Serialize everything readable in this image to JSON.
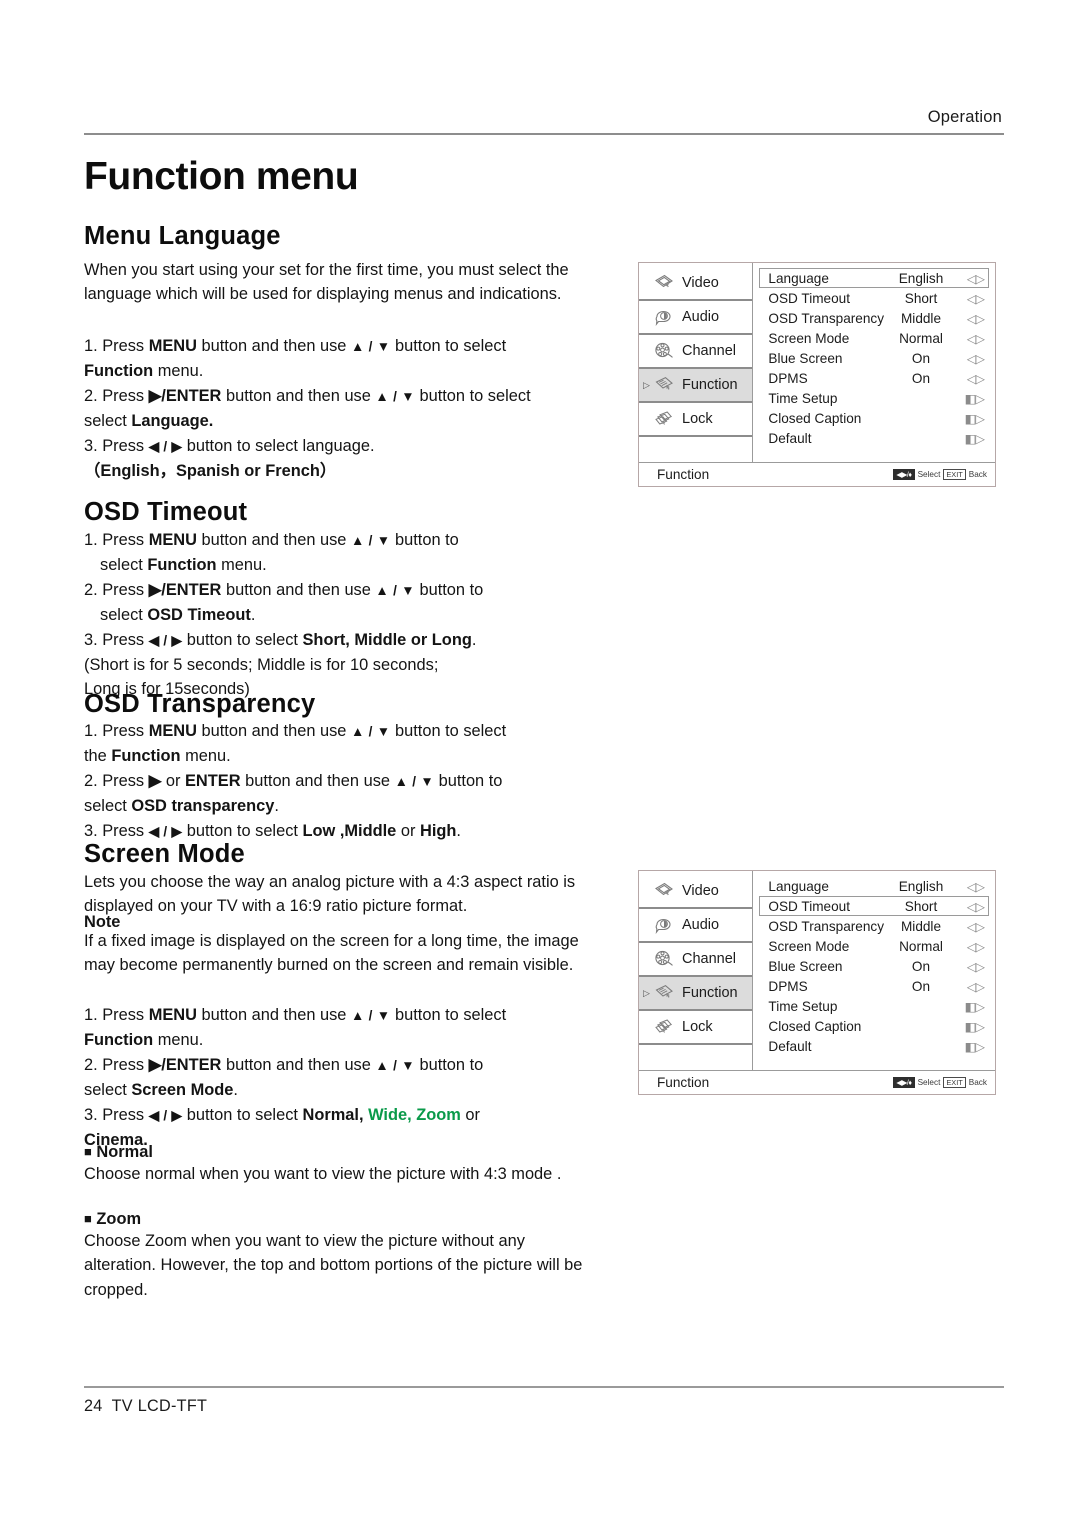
{
  "header": {
    "section": "Operation"
  },
  "title": "Function menu",
  "sections": {
    "menu_language": {
      "heading": "Menu Language",
      "intro": "When you start using your set for the first time, you must select the language which will be used for displaying menus and indications.",
      "step1_a": "1. Press ",
      "step1_b": "MENU",
      "step1_c": " button and then use ",
      "step1_arrows": "▲ / ▼",
      "step1_d": " button to select ",
      "step1_e": "Function",
      "step1_f": " menu.",
      "step2_a": "2. Press ",
      "step2_b": "▶/ENTER",
      "step2_c": " button and then use ",
      "step2_arrows": "▲ / ▼",
      "step2_d": " button to select ",
      "step2_e": "Language.",
      "step3_a": "3. Press ",
      "step3_arrows": "◀ / ▶",
      "step3_b": " button to select  language.",
      "languages": "（English，Spanish or French）"
    },
    "osd_timeout": {
      "heading": "OSD Timeout",
      "step1_a": "1. Press ",
      "step1_b": "MENU",
      "step1_c": " button and then use ",
      "step1_arrows": "▲ / ▼",
      "step1_d": " button to",
      "step1_e": "select ",
      "step1_f": "Function",
      "step1_g": " menu.",
      "step2_a": "2. Press ",
      "step2_b": "▶/ENTER",
      "step2_c": " button and then use ",
      "step2_arrows": "▲ / ▼",
      "step2_d": " button to",
      "step2_e": "select ",
      "step2_f": "OSD Timeout",
      "step2_g": ".",
      "step3_a": "3. Press ",
      "step3_arrows": "◀ / ▶",
      "step3_b": " button to select ",
      "step3_c": "Short, Middle or Long",
      "step3_d": ".",
      "note1": "(Short is for 5 seconds; Middle is for 10 seconds;",
      "note2": "Long is for 15seconds)"
    },
    "osd_transparency": {
      "heading": "OSD Transparency",
      "step1_a": "1. Press ",
      "step1_b": "MENU",
      "step1_c": " button and then use ",
      "step1_arrows": "▲ / ▼",
      "step1_d": " button to select",
      "step1_e": "the ",
      "step1_f": "Function",
      "step1_g": " menu.",
      "step2_a": "2. Press ",
      "step2_b": "▶",
      "step2_c": " or ",
      "step2_d": "ENTER",
      "step2_e": " button and then use ",
      "step2_arrows": "▲ / ▼",
      "step2_f": " button to",
      "step2_g": "select ",
      "step2_h": "OSD transparency",
      "step2_i": ".",
      "step3_a": "3. Press ",
      "step3_arrows": "◀ / ▶",
      "step3_b": " button to select ",
      "step3_c": "Low ,Middle",
      "step3_d": " or ",
      "step3_e": "High",
      "step3_f": "."
    },
    "screen_mode": {
      "heading": "Screen Mode",
      "intro": "Lets you choose the way an analog picture with a 4:3 aspect ratio is displayed on your TV with a 16:9 ratio picture format.",
      "note_label": "Note",
      "note_body": "If a fixed image is displayed on the screen for a long time, the image may become permanently burned on the screen and remain visible.",
      "step1_a": "1. Press ",
      "step1_b": "MENU",
      "step1_c": " button and then use ",
      "step1_arrows": "▲ / ▼",
      "step1_d": " button to select",
      "step1_e": "Function",
      "step1_f": " menu.",
      "step2_a": "2. Press ",
      "step2_b": "▶/ENTER",
      "step2_c": " button and then use ",
      "step2_arrows": "▲ / ▼",
      "step2_d": " button to",
      "step2_e": "select ",
      "step2_f": "Screen Mode",
      "step2_g": ".",
      "step3_a": "3. Press ",
      "step3_arrows": "◀ / ▶",
      "step3_b": " button to select ",
      "step3_c": "Normal,",
      "step3_green1": " Wide,",
      "step3_green2": " Zoom",
      "step3_d": " or",
      "step3_e": "Cinema.",
      "bullet1_label": "Normal",
      "bullet1_body": "Choose normal when you want to view the picture with 4:3 mode .",
      "bullet2_label": "Zoom",
      "bullet2_body": "Choose Zoom when you want to view the picture without any alteration. However, the top and bottom portions of the picture will be cropped."
    }
  },
  "osd_menu": {
    "sidebar": [
      {
        "label": "Video",
        "icon": "video-icon"
      },
      {
        "label": "Audio",
        "icon": "audio-icon"
      },
      {
        "label": "Channel",
        "icon": "channel-icon"
      },
      {
        "label": "Function",
        "icon": "function-icon"
      },
      {
        "label": "Lock",
        "icon": "lock-icon"
      }
    ],
    "active_sidebar": "Function",
    "rows": [
      {
        "label": "Language",
        "value": "English",
        "ctl": "◁▷"
      },
      {
        "label": "OSD Timeout",
        "value": "Short",
        "ctl": "◁▷"
      },
      {
        "label": "OSD Transparency",
        "value": "Middle",
        "ctl": "◁▷"
      },
      {
        "label": "Screen Mode",
        "value": "Normal",
        "ctl": "◁▷"
      },
      {
        "label": "Blue Screen",
        "value": "On",
        "ctl": "◁▷"
      },
      {
        "label": "DPMS",
        "value": "On",
        "ctl": "◁▷"
      },
      {
        "label": "Time Setup",
        "value": "",
        "ctl": "◧▷"
      },
      {
        "label": "Closed Caption",
        "value": "",
        "ctl": "◧▷"
      },
      {
        "label": "Default",
        "value": "",
        "ctl": "◧▷"
      }
    ],
    "footer_title": "Function",
    "hint_nav": "◀▶/♦",
    "hint_select": "Select",
    "hint_exit": "EXIT",
    "hint_back": "Back",
    "selected_row_top": "Language",
    "selected_row_bottom": "OSD Timeout"
  },
  "footer": {
    "page": "24",
    "model": "TV LCD-TFT"
  },
  "colors": {
    "accent_green": "#0a9a4a",
    "menu_border": "#b6a7a7",
    "highlight": "#dcdcdc"
  }
}
